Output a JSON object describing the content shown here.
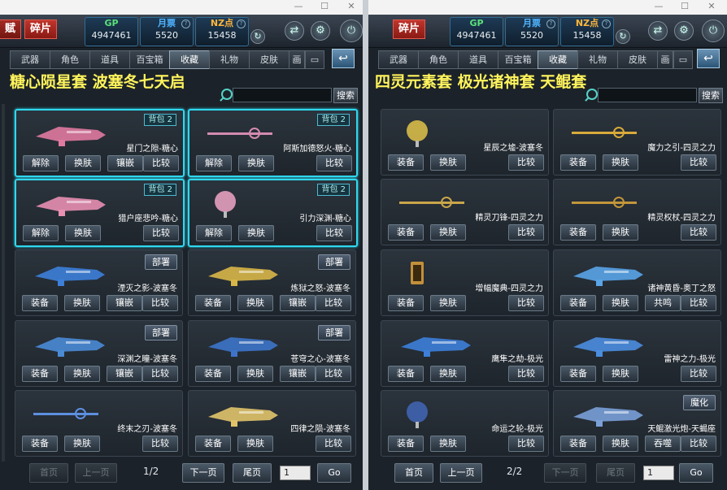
{
  "window_controls": {
    "minimize": "—",
    "maximize": "☐",
    "close": "✕"
  },
  "colors": {
    "selected_border": "#2fd8f0",
    "heading": "#fff45c",
    "gp": "#5be07a",
    "coin": "#4fb4ff",
    "nz": "#ffb63a"
  },
  "left": {
    "partial_tag": "赋",
    "tag": "碎片",
    "gp_label": "GP",
    "gp_value": "4947461",
    "coin_label": "月票",
    "coin_value": "5520",
    "nz_label": "NZ点",
    "nz_value": "15458",
    "tabs": [
      "武器",
      "角色",
      "道具",
      "百宝箱",
      "收藏",
      "礼物",
      "皮肤",
      "画"
    ],
    "heading": "糖心陨星套 波塞冬七天启",
    "search_button": "搜索",
    "items": [
      {
        "name": "星门之隙-糖心",
        "badge": "背包 2",
        "buttons": [
          "解除",
          "换肤",
          "镶嵌",
          "比较"
        ]
      },
      {
        "name": "阿斯加德怒火-糖心",
        "badge": "背包 2",
        "buttons": [
          "解除",
          "换肤",
          "比较"
        ]
      },
      {
        "name": "猎户座悲吟-糖心",
        "badge": "背包 2",
        "buttons": [
          "解除",
          "换肤",
          "比较"
        ]
      },
      {
        "name": "引力深渊-糖心",
        "badge": "背包 2",
        "buttons": [
          "解除",
          "换肤",
          "比较"
        ]
      },
      {
        "name": "湮灭之影-波塞冬",
        "deploy": "部署",
        "buttons": [
          "装备",
          "换肤",
          "镶嵌",
          "比较"
        ]
      },
      {
        "name": "炼狱之怒-波塞冬",
        "deploy": "部署",
        "buttons": [
          "装备",
          "换肤",
          "镶嵌",
          "比较"
        ]
      },
      {
        "name": "深渊之瞳-波塞冬",
        "deploy": "部署",
        "buttons": [
          "装备",
          "换肤",
          "镶嵌",
          "比较"
        ]
      },
      {
        "name": "苍穹之心-波塞冬",
        "deploy": "部署",
        "buttons": [
          "装备",
          "换肤",
          "镶嵌",
          "比较"
        ]
      },
      {
        "name": "终末之刃-波塞冬",
        "buttons": [
          "装备",
          "换肤",
          "比较"
        ]
      },
      {
        "name": "四律之陨-波塞冬",
        "buttons": [
          "装备",
          "换肤",
          "比较"
        ]
      }
    ],
    "pager": {
      "first": "首页",
      "prev": "上一页",
      "page": "1/2",
      "next": "下一页",
      "last": "尾页",
      "input": "1",
      "go": "Go"
    }
  },
  "right": {
    "tag": "碎片",
    "gp_label": "GP",
    "gp_value": "4947461",
    "coin_label": "月票",
    "coin_value": "5520",
    "nz_label": "NZ点",
    "nz_value": "15458",
    "tabs": [
      "武器",
      "角色",
      "道具",
      "百宝箱",
      "收藏",
      "礼物",
      "皮肤",
      "画"
    ],
    "heading": "四灵元素套 极光诸神套 天鲲套",
    "search_button": "搜索",
    "items": [
      {
        "name": "星辰之墟-波塞冬",
        "buttons": [
          "装备",
          "换肤",
          "比较"
        ]
      },
      {
        "name": "魔力之引-四灵之力",
        "buttons": [
          "装备",
          "换肤",
          "比较"
        ]
      },
      {
        "name": "精灵刀锋-四灵之力",
        "buttons": [
          "装备",
          "换肤",
          "比较"
        ]
      },
      {
        "name": "精灵权杖-四灵之力",
        "buttons": [
          "装备",
          "换肤",
          "比较"
        ]
      },
      {
        "name": "增幅魔典-四灵之力",
        "buttons": [
          "装备",
          "换肤",
          "比较"
        ]
      },
      {
        "name": "诸神黄昏-奥丁之怒",
        "buttons": [
          "装备",
          "换肤",
          "共鸣",
          "比较"
        ]
      },
      {
        "name": "鹰隼之劫-极光",
        "buttons": [
          "装备",
          "换肤",
          "比较"
        ]
      },
      {
        "name": "雷神之力-极光",
        "buttons": [
          "装备",
          "换肤",
          "比较"
        ]
      },
      {
        "name": "命运之轮-极光",
        "buttons": [
          "装备",
          "换肤",
          "比较"
        ]
      },
      {
        "name": "天鲲激光炮-天蝎座",
        "deploy": "魔化",
        "buttons": [
          "装备",
          "换肤",
          "吞噬",
          "比较"
        ]
      }
    ],
    "pager": {
      "first": "首页",
      "prev": "上一页",
      "page": "2/2",
      "next": "下一页",
      "last": "尾页",
      "input": "1",
      "go": "Go"
    }
  }
}
